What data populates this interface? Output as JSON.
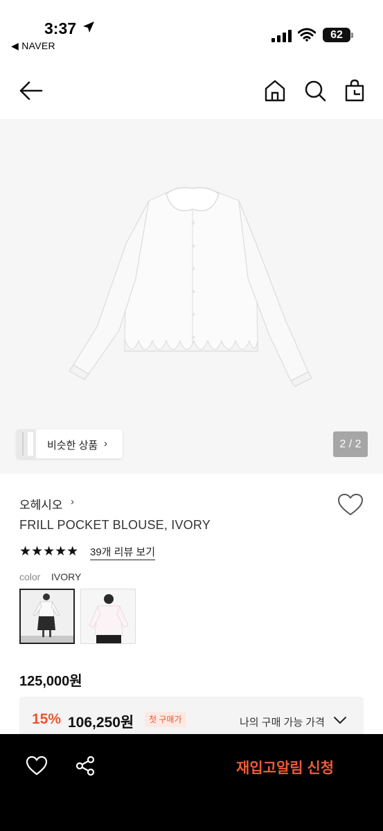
{
  "status_bar": {
    "time": "3:37",
    "back_app": "◀ NAVER",
    "battery": "62"
  },
  "nav": {
    "icons": [
      "back-arrow-icon",
      "home-icon",
      "search-icon",
      "shopping-bag-icon"
    ]
  },
  "gallery": {
    "similar_label": "비슷한 상품",
    "similar_chevron": "›",
    "page_indicator": "2 / 2"
  },
  "product": {
    "brand": "오헤시오",
    "brand_chevron": "›",
    "name": "FRILL POCKET BLOUSE, IVORY",
    "stars": "★★★★★",
    "rating": 5,
    "review_link": "39개 리뷰 보기",
    "color_label": "color",
    "color_value": "IVORY",
    "price": "125,000원"
  },
  "discount": {
    "percent": "15%",
    "price": "106,250원",
    "badge": "첫 구매가",
    "my_price_label": "나의 구매 가능 가격"
  },
  "bottom_bar": {
    "restock_label": "재입고알림 신청"
  },
  "colors": {
    "accent": "#e8572f",
    "restock": "#f05a3a",
    "bottom_bar": "#000000"
  }
}
